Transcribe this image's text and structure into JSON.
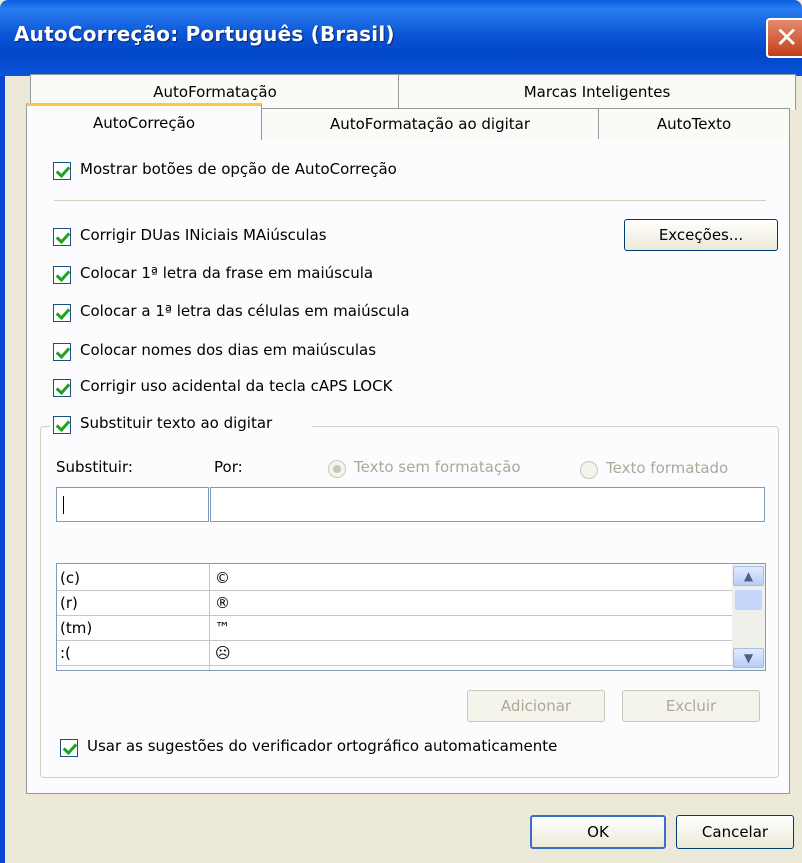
{
  "window": {
    "title": "AutoCorreção: Português (Brasil)"
  },
  "tabs_row1": [
    {
      "label": "AutoFormatação"
    },
    {
      "label": "Marcas Inteligentes"
    }
  ],
  "tabs_row2": [
    {
      "label": "AutoCorreção",
      "selected": true
    },
    {
      "label": "AutoFormatação ao digitar"
    },
    {
      "label": "AutoTexto"
    }
  ],
  "options": {
    "show_buttons": {
      "label": "Mostrar botões de opção de AutoCorreção",
      "checked": true
    },
    "two_initials": {
      "label": "Corrigir DUas INiciais MAiúsculas",
      "checked": true
    },
    "first_letter_sentence": {
      "label": "Colocar 1ª letra da frase em maiúscula",
      "checked": true
    },
    "first_letter_cells": {
      "label": "Colocar a 1ª letra das células em maiúscula",
      "checked": true
    },
    "day_names": {
      "label": "Colocar nomes dos dias em maiúsculas",
      "checked": true
    },
    "caps_lock": {
      "label": "Corrigir uso acidental da tecla cAPS LOCK",
      "checked": true
    },
    "replace_text": {
      "label": "Substituir texto ao digitar",
      "checked": true
    },
    "spell_suggestions": {
      "label": "Usar as sugestões do verificador ortográfico automaticamente",
      "checked": true
    }
  },
  "exceptions_button": "Exceções...",
  "replace": {
    "replace_label": "Substituir:",
    "with_label": "Por:",
    "plain_text_radio": "Texto sem formatação",
    "formatted_text_radio": "Texto formatado",
    "replace_value": "",
    "with_value": "",
    "list": [
      {
        "from": "(c)",
        "to": "©"
      },
      {
        "from": "(r)",
        "to": "®"
      },
      {
        "from": "(tm)",
        "to": "™"
      },
      {
        "from": ":(",
        "to": "☹"
      }
    ],
    "add_button": "Adicionar",
    "delete_button": "Excluir"
  },
  "footer": {
    "ok": "OK",
    "cancel": "Cancelar"
  },
  "colors": {
    "titlebar": "#0046c8",
    "selected_tab_accent": "#ffc83c",
    "check": "#21a121"
  }
}
